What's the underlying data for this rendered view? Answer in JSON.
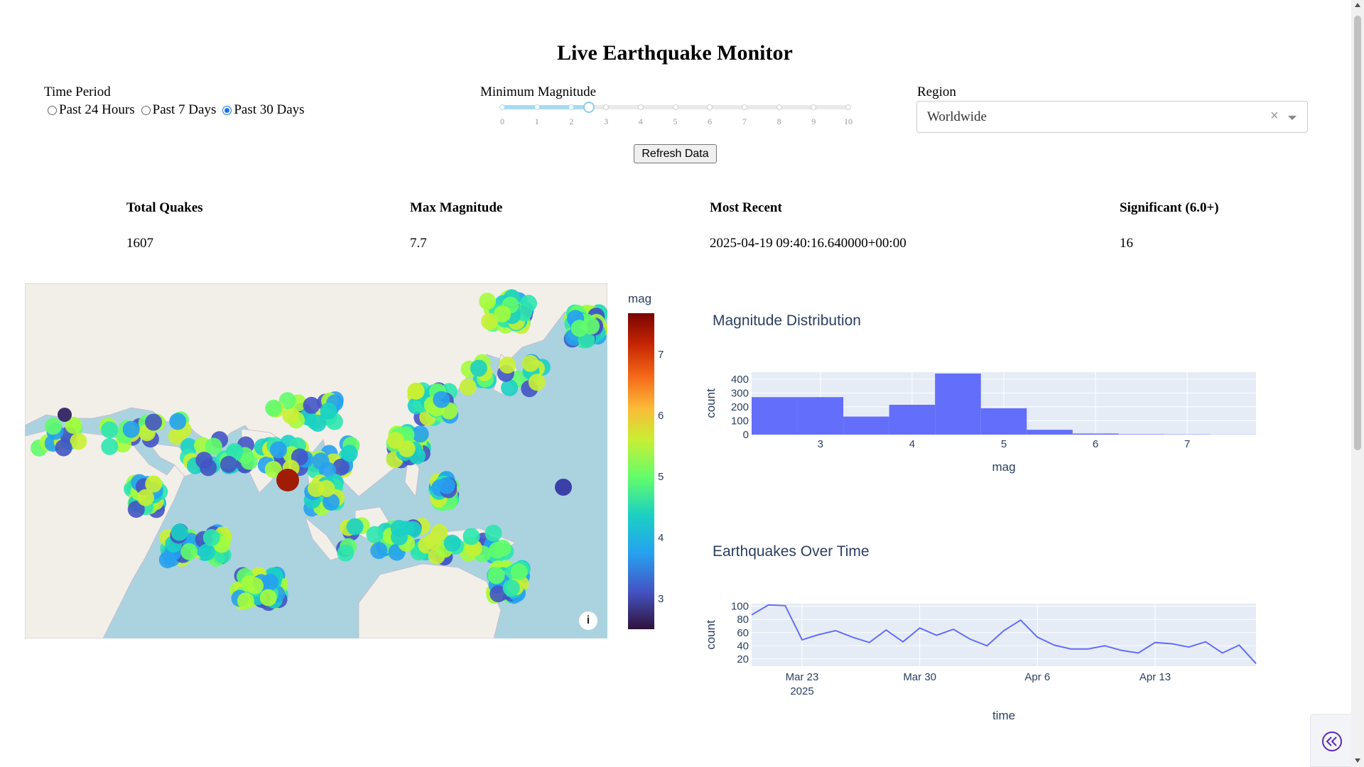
{
  "header": {
    "title": "Live Earthquake Monitor"
  },
  "controls": {
    "time_period": {
      "label": "Time Period",
      "options": [
        "Past 24 Hours",
        "Past 7 Days",
        "Past 30 Days"
      ],
      "selected": "Past 30 Days"
    },
    "min_magnitude": {
      "label": "Minimum Magnitude",
      "marks": [
        "0",
        "1",
        "2",
        "3",
        "4",
        "5",
        "6",
        "7",
        "8",
        "9",
        "10"
      ],
      "value": 2.5
    },
    "region": {
      "label": "Region",
      "value": "Worldwide",
      "clear_glyph": "×"
    },
    "refresh_label": "Refresh Data"
  },
  "stats": {
    "total_label": "Total Quakes",
    "total_value": "1607",
    "max_label": "Max Magnitude",
    "max_value": "7.7",
    "recent_label": "Most Recent",
    "recent_value": "2025-04-19 09:40:16.640000+00:00",
    "significant_label": "Significant (6.0+)",
    "significant_value": "16"
  },
  "map": {
    "colorbar_title": "mag",
    "colorbar_ticks": [
      "3",
      "4",
      "5",
      "6",
      "7"
    ],
    "info_glyph": "i"
  },
  "chart_data": [
    {
      "type": "bar",
      "title": "Magnitude Distribution",
      "xlabel": "mag",
      "ylabel": "count",
      "x_ticks": [
        "3",
        "4",
        "5",
        "6",
        "7"
      ],
      "y_ticks": [
        "0",
        "100",
        "200",
        "300",
        "400"
      ],
      "bins": [
        {
          "start": 2.25,
          "end": 2.75,
          "value": 270
        },
        {
          "start": 2.75,
          "end": 3.25,
          "value": 270
        },
        {
          "start": 3.25,
          "end": 3.75,
          "value": 130
        },
        {
          "start": 3.75,
          "end": 4.25,
          "value": 215
        },
        {
          "start": 4.25,
          "end": 4.75,
          "value": 440
        },
        {
          "start": 4.75,
          "end": 5.25,
          "value": 190
        },
        {
          "start": 5.25,
          "end": 5.75,
          "value": 35
        },
        {
          "start": 5.75,
          "end": 6.25,
          "value": 8
        },
        {
          "start": 6.25,
          "end": 6.75,
          "value": 3
        },
        {
          "start": 6.75,
          "end": 7.25,
          "value": 2
        },
        {
          "start": 7.25,
          "end": 7.75,
          "value": 1
        }
      ],
      "xlim": [
        2.25,
        7.75
      ],
      "ylim": [
        0,
        450
      ],
      "color": "#636efa",
      "grid": true
    },
    {
      "type": "line",
      "title": "Earthquakes Over Time",
      "xlabel": "time",
      "ylabel": "count",
      "x_ticks": [
        "Mar 23",
        "Mar 30",
        "Apr 6",
        "Apr 13"
      ],
      "x_tick_year": "2025",
      "y_ticks": [
        "20",
        "40",
        "60",
        "80",
        "100"
      ],
      "x": [
        "2025-03-20",
        "2025-03-21",
        "2025-03-22",
        "2025-03-23",
        "2025-03-24",
        "2025-03-25",
        "2025-03-26",
        "2025-03-27",
        "2025-03-28",
        "2025-03-29",
        "2025-03-30",
        "2025-03-31",
        "2025-04-01",
        "2025-04-02",
        "2025-04-03",
        "2025-04-04",
        "2025-04-05",
        "2025-04-06",
        "2025-04-07",
        "2025-04-08",
        "2025-04-09",
        "2025-04-10",
        "2025-04-11",
        "2025-04-12",
        "2025-04-13",
        "2025-04-14",
        "2025-04-15",
        "2025-04-16",
        "2025-04-17",
        "2025-04-18",
        "2025-04-19"
      ],
      "values": [
        87,
        102,
        101,
        49,
        57,
        63,
        53,
        45,
        64,
        46,
        67,
        56,
        65,
        50,
        40,
        63,
        79,
        53,
        41,
        35,
        35,
        40,
        33,
        29,
        45,
        43,
        38,
        46,
        29,
        41,
        13
      ],
      "xlim": [
        "2025-03-20",
        "2025-04-19"
      ],
      "ylim": [
        9,
        104
      ],
      "color": "#636efa",
      "grid": true
    }
  ]
}
